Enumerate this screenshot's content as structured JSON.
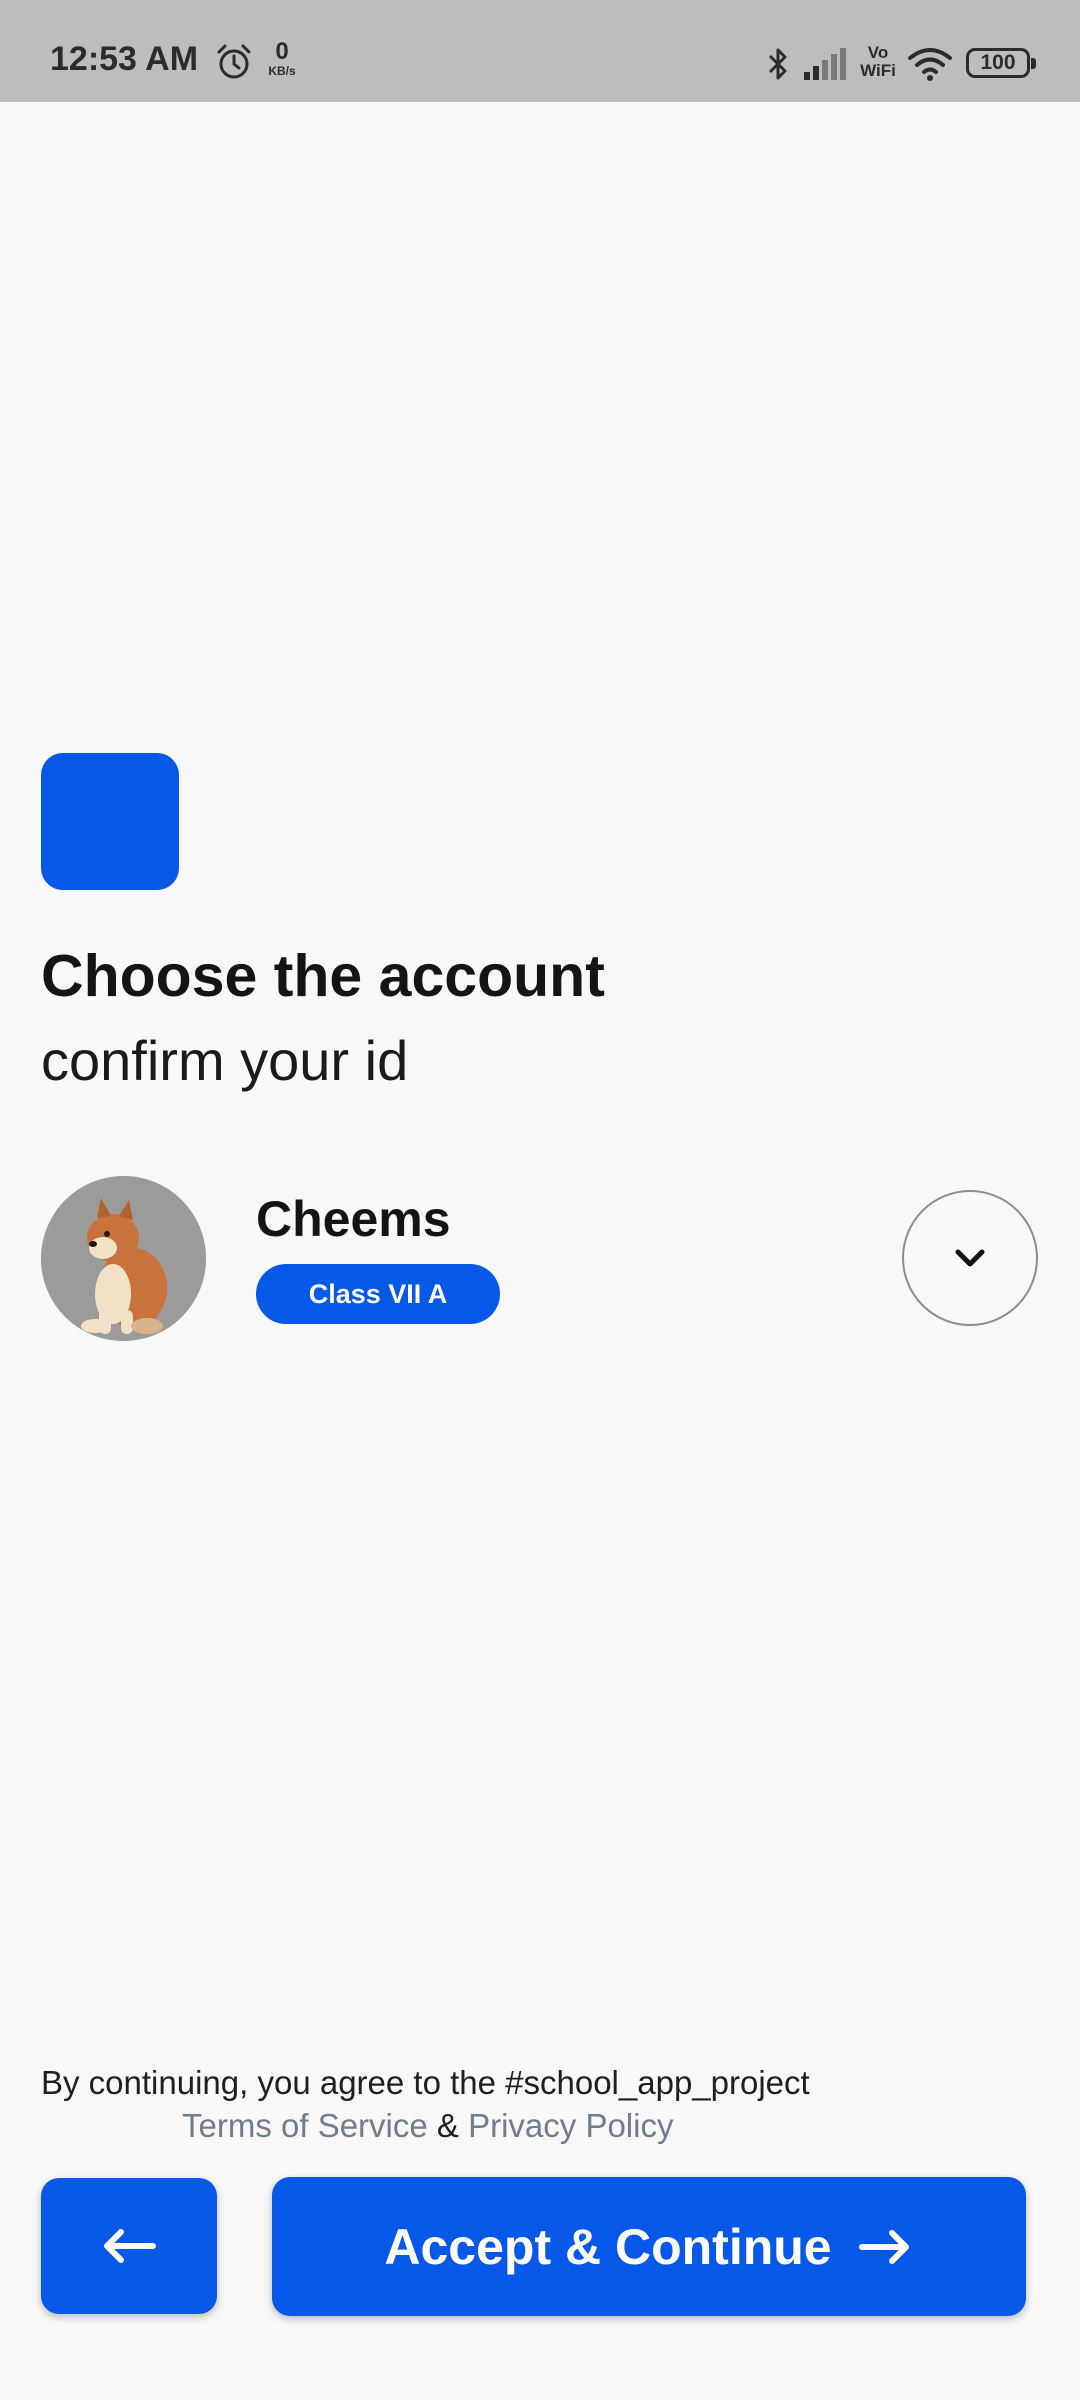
{
  "status_bar": {
    "time": "12:53 AM",
    "net_speed_value": "0",
    "net_speed_unit": "KB/s",
    "vowifi_line1": "Vo",
    "vowifi_line2": "WiFi",
    "battery": "100",
    "icons": [
      "alarm-icon",
      "bluetooth-icon",
      "signal-icon",
      "wifi-icon",
      "battery-icon"
    ]
  },
  "colors": {
    "accent": "#0558e8",
    "background": "#f8f8f9",
    "status_bar": "#bdbdbd",
    "link": "#6f7d8c"
  },
  "header": {
    "title": "Choose the account",
    "subtitle": "confirm your id"
  },
  "account": {
    "name": "Cheems",
    "class_label": "Class VII A",
    "avatar_icon": "dog-avatar",
    "dropdown_icon": "chevron-down-icon"
  },
  "consent": {
    "line1": "By continuing, you agree to the #school_app_project",
    "terms": "Terms of Service",
    "and": "&",
    "privacy": "Privacy Policy"
  },
  "actions": {
    "back_icon": "arrow-left-icon",
    "continue_label": "Accept & Continue",
    "continue_icon": "arrow-right-icon"
  }
}
